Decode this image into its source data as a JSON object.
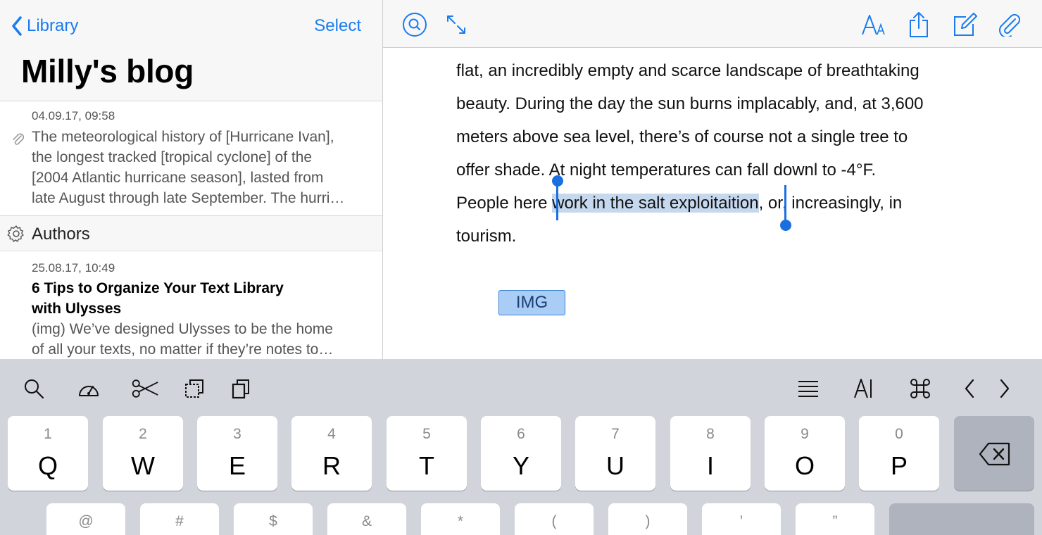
{
  "sidebar": {
    "back_label": "Library",
    "select_label": "Select",
    "title": "Milly's blog",
    "sheets": [
      {
        "date": "04.09.17, 09:58",
        "lines": [
          "The meteorological history of [Hurricane Ivan],",
          "the longest tracked [tropical cyclone] of the",
          "[2004 Atlantic hurricane season], lasted from",
          "late August through late September. The hurri…"
        ]
      },
      {
        "date": "25.08.17, 10:49",
        "title_lines": [
          "6 Tips to Organize Your Text Library",
          "with Ulysses"
        ],
        "lines": [
          "(img) We’ve designed Ulysses to be the home",
          "of all your texts, no matter if they’re notes to…"
        ]
      }
    ],
    "group_label": "Authors"
  },
  "editor": {
    "lines": [
      "flat, an incredibly empty and scarce landscape of breathtaking",
      "beauty. During the day the sun burns implacably, and, at 3,600",
      "meters above sea level, there’s of course not a single tree to",
      "offer shade. At night temperatures can fall downl to -4°F."
    ],
    "line5_before": "People here ",
    "line5_selected": "work in the salt exploitaition",
    "line5_after": ", or, increasingly, in",
    "line6": "tourism.",
    "img_label": "IMG"
  },
  "keyboard": {
    "row1": [
      {
        "num": "1",
        "ch": "Q"
      },
      {
        "num": "2",
        "ch": "W"
      },
      {
        "num": "3",
        "ch": "E"
      },
      {
        "num": "4",
        "ch": "R"
      },
      {
        "num": "5",
        "ch": "T"
      },
      {
        "num": "6",
        "ch": "Y"
      },
      {
        "num": "7",
        "ch": "U"
      },
      {
        "num": "8",
        "ch": "I"
      },
      {
        "num": "9",
        "ch": "O"
      },
      {
        "num": "0",
        "ch": "P"
      }
    ],
    "row2_symbols": [
      "@",
      "#",
      "$",
      "&",
      "*",
      "(",
      ")",
      "’",
      "”"
    ]
  },
  "colors": {
    "accent": "#1a7cf0",
    "selection": "#c6d8ee",
    "keyboard_bg": "#d1d5db"
  }
}
